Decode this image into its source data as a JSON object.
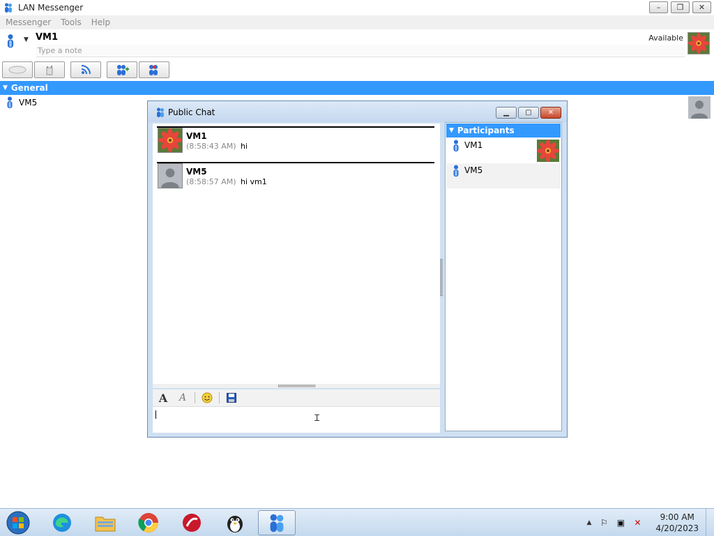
{
  "main_window": {
    "title": "LAN Messenger",
    "controls": {
      "minimize": "–",
      "restore": "❐",
      "close": "✕"
    }
  },
  "menu": [
    "Messenger",
    "Tools",
    "Help"
  ],
  "user": {
    "name": "VM1",
    "note_placeholder": "Type a note",
    "status": "Available"
  },
  "groups": [
    {
      "name": "General",
      "contacts": [
        "VM5"
      ]
    }
  ],
  "chat_window": {
    "title": "Public Chat",
    "messages": [
      {
        "sender": "VM1",
        "time": "(8:58:43 AM)",
        "text": "hi",
        "avatar": "flower"
      },
      {
        "sender": "VM5",
        "time": "(8:58:57 AM)",
        "text": "hi vm1",
        "avatar": "default-person"
      }
    ],
    "participants_header": "Participants",
    "participants": [
      {
        "name": "VM1",
        "avatar": "flower"
      },
      {
        "name": "VM5",
        "avatar": "none"
      }
    ]
  },
  "taskbar": {
    "apps": [
      "edge",
      "file-explorer",
      "chrome",
      "security-app",
      "penguin-app",
      "lan-messenger"
    ],
    "time": "9:00 AM",
    "date": "4/20/2023"
  },
  "colors": {
    "accent": "#3399ff",
    "chat_frame": "#cfe0f2",
    "close_red": "#c7452a"
  }
}
